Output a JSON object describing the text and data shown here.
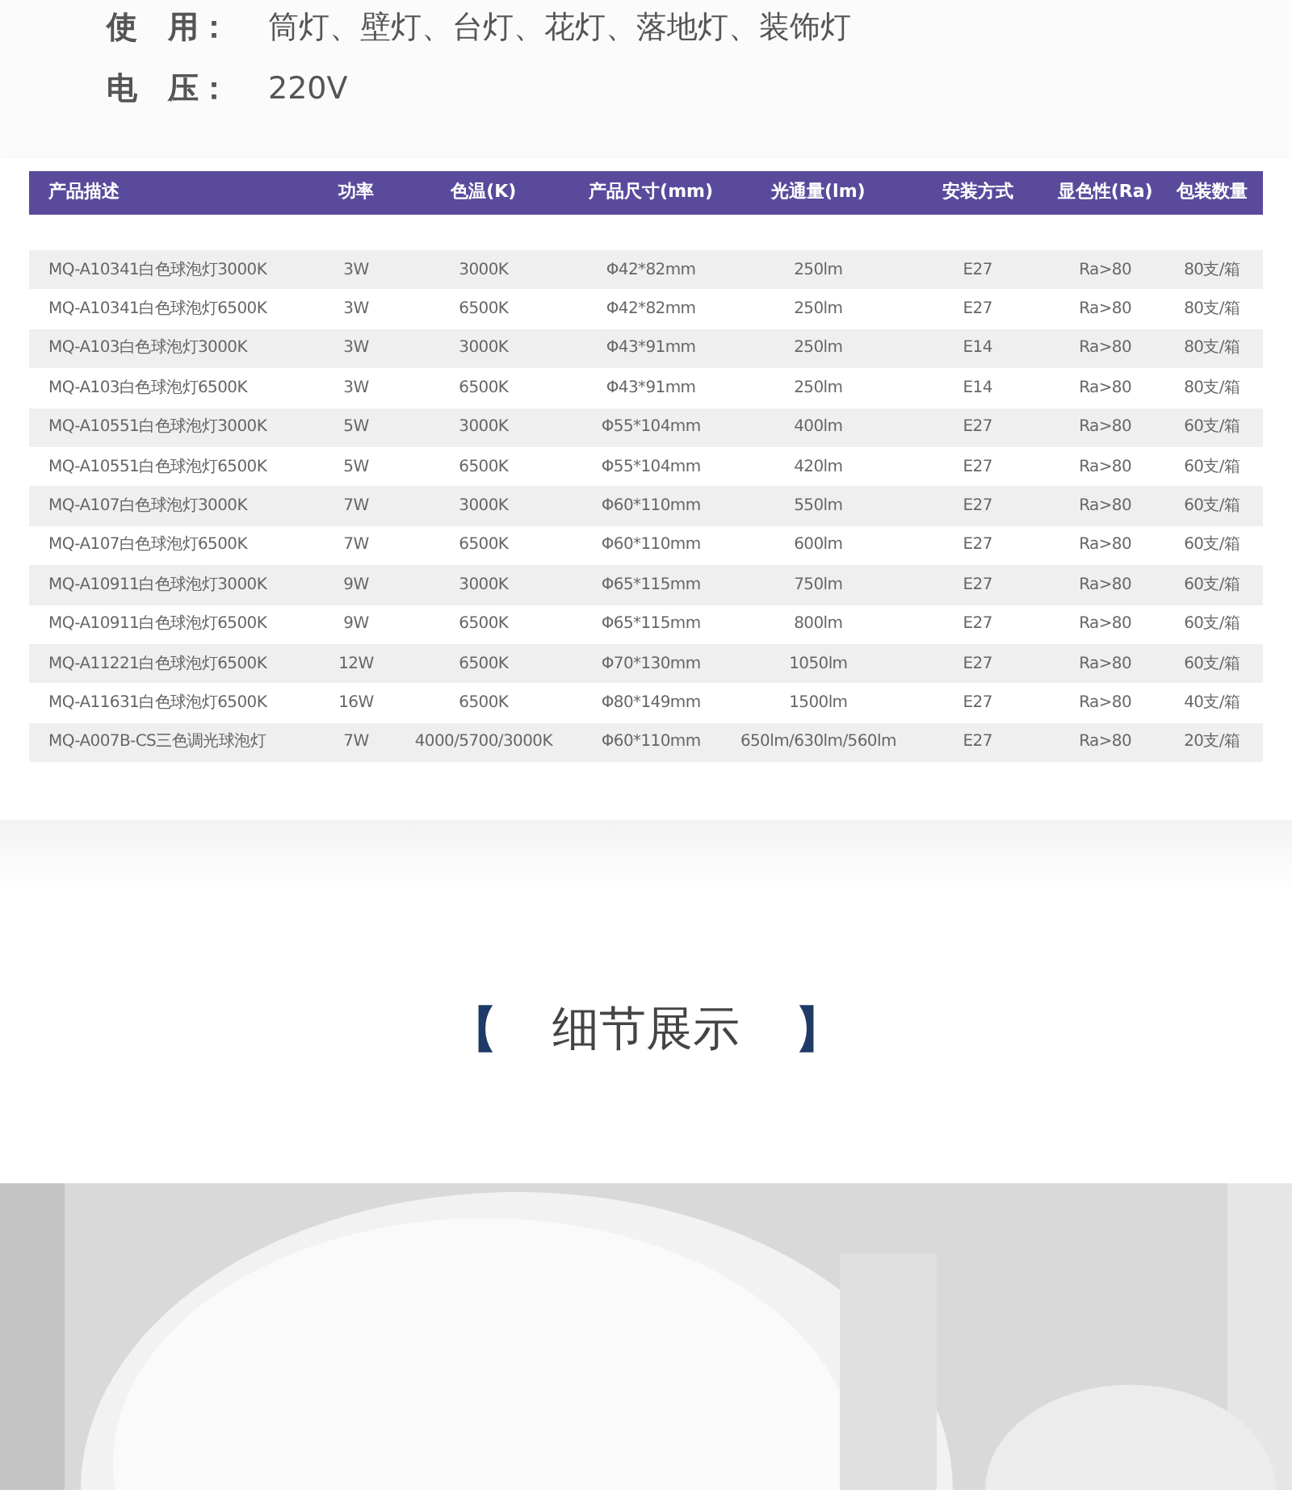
{
  "specs": [
    {
      "label": "使　用：",
      "value": "筒灯、壁灯、台灯、花灯、落地灯、装饰灯"
    },
    {
      "label": "电　压：",
      "value": "220V"
    }
  ],
  "table": {
    "columns": [
      "产品描述",
      "功率",
      "色温(K)",
      "产品尺寸(mm)",
      "光通量(lm)",
      "安装方式",
      "显色性(Ra)",
      "包装数量"
    ],
    "rows": [
      [
        "MQ-A10341白色球泡灯3000K",
        "3W",
        "3000K",
        "Φ42*82mm",
        "250lm",
        "E27",
        "Ra>80",
        "80支/箱"
      ],
      [
        "MQ-A10341白色球泡灯6500K",
        "3W",
        "6500K",
        "Φ42*82mm",
        "250lm",
        "E27",
        "Ra>80",
        "80支/箱"
      ],
      [
        "MQ-A103白色球泡灯3000K",
        "3W",
        "3000K",
        "Φ43*91mm",
        "250lm",
        "E14",
        "Ra>80",
        "80支/箱"
      ],
      [
        "MQ-A103白色球泡灯6500K",
        "3W",
        "6500K",
        "Φ43*91mm",
        "250lm",
        "E14",
        "Ra>80",
        "80支/箱"
      ],
      [
        "MQ-A10551白色球泡灯3000K",
        "5W",
        "3000K",
        "Φ55*104mm",
        "400lm",
        "E27",
        "Ra>80",
        "60支/箱"
      ],
      [
        "MQ-A10551白色球泡灯6500K",
        "5W",
        "6500K",
        "Φ55*104mm",
        "420lm",
        "E27",
        "Ra>80",
        "60支/箱"
      ],
      [
        "MQ-A107白色球泡灯3000K",
        "7W",
        "3000K",
        "Φ60*110mm",
        "550lm",
        "E27",
        "Ra>80",
        "60支/箱"
      ],
      [
        "MQ-A107白色球泡灯6500K",
        "7W",
        "6500K",
        "Φ60*110mm",
        "600lm",
        "E27",
        "Ra>80",
        "60支/箱"
      ],
      [
        "MQ-A10911白色球泡灯3000K",
        "9W",
        "3000K",
        "Φ65*115mm",
        "750lm",
        "E27",
        "Ra>80",
        "60支/箱"
      ],
      [
        "MQ-A10911白色球泡灯6500K",
        "9W",
        "6500K",
        "Φ65*115mm",
        "800lm",
        "E27",
        "Ra>80",
        "60支/箱"
      ],
      [
        "MQ-A11221白色球泡灯6500K",
        "12W",
        "6500K",
        "Φ70*130mm",
        "1050lm",
        "E27",
        "Ra>80",
        "60支/箱"
      ],
      [
        "MQ-A11631白色球泡灯6500K",
        "16W",
        "6500K",
        "Φ80*149mm",
        "1500lm",
        "E27",
        "Ra>80",
        "40支/箱"
      ],
      [
        "MQ-A007B-CS三色调光球泡灯",
        "7W",
        "4000/5700/3000K",
        "Φ60*110mm",
        "650lm/630lm/560lm",
        "E27",
        "Ra>80",
        "20支/箱"
      ]
    ]
  },
  "section": {
    "open_bracket": "【",
    "title": "细节展示",
    "close_bracket": "】"
  }
}
